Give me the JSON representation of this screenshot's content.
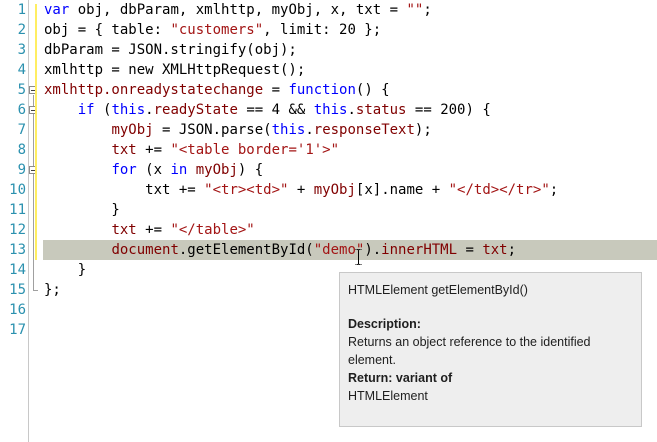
{
  "editor": {
    "line_numbers": [
      "1",
      "2",
      "3",
      "4",
      "5",
      "6",
      "7",
      "8",
      "9",
      "10",
      "11",
      "12",
      "13",
      "14",
      "15",
      "16",
      "17"
    ],
    "lines": [
      [
        {
          "t": "var",
          "c": "kw"
        },
        {
          "t": " obj, dbParam, xmlhttp, myObj, x, txt = ",
          "c": "id"
        },
        {
          "t": "\"\"",
          "c": "str"
        },
        {
          "t": ";",
          "c": "id"
        }
      ],
      [
        {
          "t": "obj = { table: ",
          "c": "id"
        },
        {
          "t": "\"customers\"",
          "c": "str"
        },
        {
          "t": ", limit: 20 };",
          "c": "id"
        }
      ],
      [
        {
          "t": "dbParam = JSON.stringify(obj);",
          "c": "id"
        }
      ],
      [
        {
          "t": "xmlhttp = new XMLHttpRequest();",
          "c": "id"
        }
      ],
      [
        {
          "t": "xmlhttp.onreadystatechange",
          "c": "prop"
        },
        {
          "t": " = ",
          "c": "id"
        },
        {
          "t": "function",
          "c": "kw"
        },
        {
          "t": "() {",
          "c": "id"
        }
      ],
      [
        {
          "t": "    ",
          "c": "id"
        },
        {
          "t": "if",
          "c": "kw"
        },
        {
          "t": " (",
          "c": "id"
        },
        {
          "t": "this",
          "c": "kw"
        },
        {
          "t": ".",
          "c": "id"
        },
        {
          "t": "readyState",
          "c": "prop"
        },
        {
          "t": " == 4 && ",
          "c": "id"
        },
        {
          "t": "this",
          "c": "kw"
        },
        {
          "t": ".",
          "c": "id"
        },
        {
          "t": "status",
          "c": "prop"
        },
        {
          "t": " == 200) {",
          "c": "id"
        }
      ],
      [
        {
          "t": "        ",
          "c": "id"
        },
        {
          "t": "myObj",
          "c": "prop"
        },
        {
          "t": " = JSON.parse(",
          "c": "id"
        },
        {
          "t": "this",
          "c": "kw"
        },
        {
          "t": ".",
          "c": "id"
        },
        {
          "t": "responseText",
          "c": "prop"
        },
        {
          "t": ");",
          "c": "id"
        }
      ],
      [
        {
          "t": "        ",
          "c": "id"
        },
        {
          "t": "txt",
          "c": "prop"
        },
        {
          "t": " += ",
          "c": "id"
        },
        {
          "t": "\"<table border='1'>\"",
          "c": "str"
        }
      ],
      [
        {
          "t": "        ",
          "c": "id"
        },
        {
          "t": "for",
          "c": "kw"
        },
        {
          "t": " (x ",
          "c": "id"
        },
        {
          "t": "in",
          "c": "kw"
        },
        {
          "t": " ",
          "c": "id"
        },
        {
          "t": "myObj",
          "c": "prop"
        },
        {
          "t": ") {",
          "c": "id"
        }
      ],
      [
        {
          "t": "            txt += ",
          "c": "id"
        },
        {
          "t": "\"<tr><td>\"",
          "c": "str"
        },
        {
          "t": " + ",
          "c": "id"
        },
        {
          "t": "myObj",
          "c": "prop"
        },
        {
          "t": "[x].name + ",
          "c": "id"
        },
        {
          "t": "\"</td></tr>\"",
          "c": "str"
        },
        {
          "t": ";",
          "c": "id"
        }
      ],
      [
        {
          "t": "        }",
          "c": "id"
        }
      ],
      [
        {
          "t": "        ",
          "c": "id"
        },
        {
          "t": "txt",
          "c": "prop"
        },
        {
          "t": " += ",
          "c": "id"
        },
        {
          "t": "\"</table>\"",
          "c": "str"
        }
      ],
      [
        {
          "t": "        ",
          "c": "id"
        },
        {
          "t": "document",
          "c": "prop"
        },
        {
          "t": ".getElementById(",
          "c": "id"
        },
        {
          "t": "\"demo\"",
          "c": "str"
        },
        {
          "t": ").",
          "c": "id"
        },
        {
          "t": "innerHTML",
          "c": "prop"
        },
        {
          "t": " = ",
          "c": "id"
        },
        {
          "t": "txt",
          "c": "prop"
        },
        {
          "t": ";",
          "c": "id"
        }
      ],
      [
        {
          "t": "    }",
          "c": "id"
        }
      ],
      [
        {
          "t": "};",
          "c": "id"
        }
      ],
      [],
      []
    ],
    "highlighted_line": "13"
  },
  "tooltip": {
    "signature": "HTMLElement getElementById()",
    "description_label": "Description:",
    "description_text": "Returns an object reference to the identified element.",
    "return_label": "Return: variant of",
    "return_value": "HTMLElement"
  },
  "colors": {
    "keyword": "#0000ff",
    "string": "#a31515",
    "property": "#800000",
    "line_number": "#2b91af",
    "highlight": "#c8c9bc"
  }
}
